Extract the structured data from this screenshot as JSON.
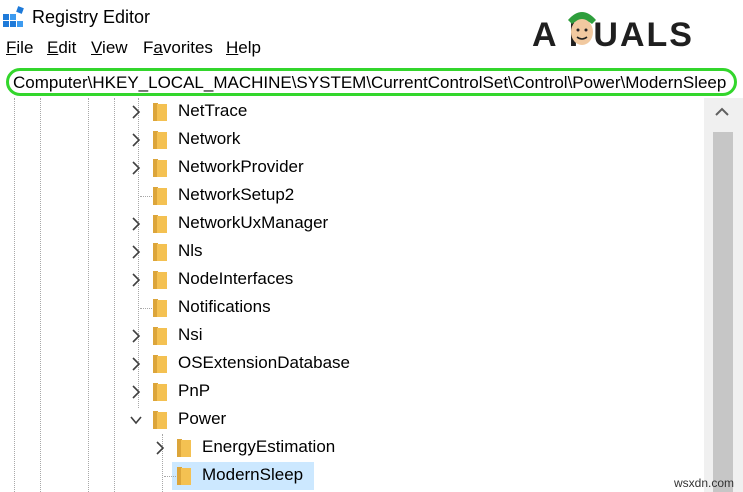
{
  "window": {
    "title": "Registry Editor"
  },
  "watermark": {
    "text": "A  PUALS",
    "site": "wsxdn.com"
  },
  "menu": [
    {
      "label": "File",
      "mnemonic": "F",
      "rest": "ile"
    },
    {
      "label": "Edit",
      "mnemonic": "E",
      "rest": "dit"
    },
    {
      "label": "View",
      "mnemonic": "V",
      "rest": "iew"
    },
    {
      "label": "Favorites",
      "mnemonic": "",
      "first": "F",
      "mnemonic_mid": "a",
      "rest": "vorites"
    },
    {
      "label": "Help",
      "mnemonic": "H",
      "rest": "elp"
    }
  ],
  "address": {
    "path": "Computer\\HKEY_LOCAL_MACHINE\\SYSTEM\\CurrentControlSet\\Control\\Power\\ModernSleep"
  },
  "tree": {
    "items": [
      {
        "label": "NetTrace",
        "expand": "collapsed",
        "level": 0
      },
      {
        "label": "Network",
        "expand": "collapsed",
        "level": 0
      },
      {
        "label": "NetworkProvider",
        "expand": "collapsed",
        "level": 0
      },
      {
        "label": "NetworkSetup2",
        "expand": "none",
        "level": 0
      },
      {
        "label": "NetworkUxManager",
        "expand": "collapsed",
        "level": 0
      },
      {
        "label": "Nls",
        "expand": "collapsed",
        "level": 0
      },
      {
        "label": "NodeInterfaces",
        "expand": "collapsed",
        "level": 0
      },
      {
        "label": "Notifications",
        "expand": "none",
        "level": 0
      },
      {
        "label": "Nsi",
        "expand": "collapsed",
        "level": 0
      },
      {
        "label": "OSExtensionDatabase",
        "expand": "collapsed",
        "level": 0
      },
      {
        "label": "PnP",
        "expand": "collapsed",
        "level": 0
      },
      {
        "label": "Power",
        "expand": "expanded",
        "level": 0
      },
      {
        "label": "EnergyEstimation",
        "expand": "collapsed",
        "level": 1
      },
      {
        "label": "ModernSleep",
        "expand": "none",
        "level": 1,
        "selected": true
      }
    ]
  },
  "colors": {
    "address_highlight": "#33d62c",
    "selection": "#cce8ff",
    "folder": "#f4c152",
    "folder_dark": "#dca53a"
  }
}
